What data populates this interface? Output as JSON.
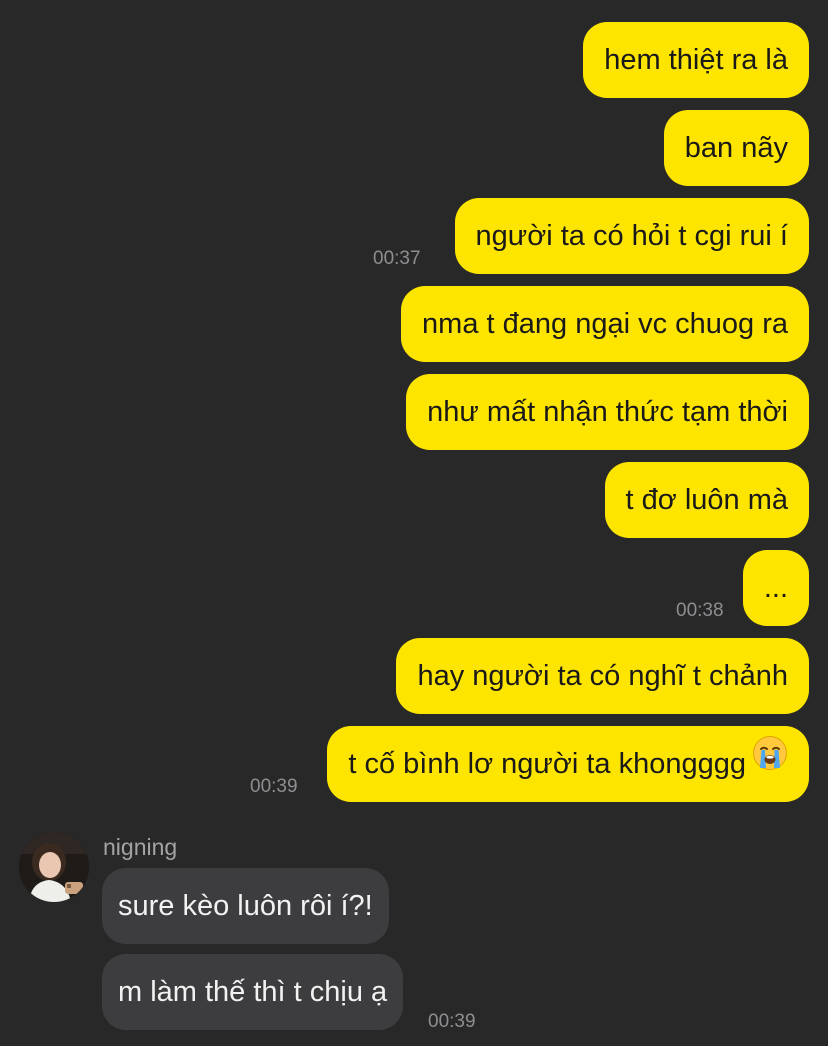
{
  "colors": {
    "background": "#282828",
    "outgoing_bubble": "#FEE500",
    "incoming_bubble": "#3D3D3F",
    "timestamp": "#8E8E92"
  },
  "messages": {
    "out": [
      {
        "text": "hem thiệt ra là"
      },
      {
        "text": "ban nãy"
      },
      {
        "text": "người ta có hỏi t cgi rui í",
        "time": "00:37"
      },
      {
        "text": "nma t đang ngại vc chuog ra"
      },
      {
        "text": "như mất nhận thức tạm thời"
      },
      {
        "text": "t đơ luôn mà"
      },
      {
        "text": "...",
        "time": "00:38"
      },
      {
        "text": "hay người ta có nghĩ t chảnh"
      },
      {
        "text": "t cố bình lơ người ta khongggg",
        "emoji": "loudly-crying-face-icon",
        "time": "00:39"
      }
    ],
    "sender_name": "nigning",
    "in": [
      {
        "text": "sure kèo luôn rôi í?!"
      },
      {
        "text": "m làm thế thì t chịu ạ",
        "time": "00:39"
      }
    ]
  }
}
